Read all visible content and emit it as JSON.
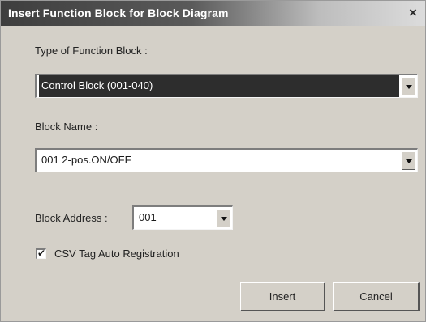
{
  "dialog": {
    "title": "Insert Function Block for Block Diagram",
    "close_glyph": "×"
  },
  "type_field": {
    "label": "Type of Function Block :",
    "value": "Control Block (001-040)"
  },
  "name_field": {
    "label": "Block Name :",
    "value": "001  2-pos.ON/OFF"
  },
  "address_field": {
    "label": "Block Address :",
    "value": "001"
  },
  "csv_checkbox": {
    "label": "CSV Tag Auto Registration",
    "checked": true,
    "check_glyph": "✔"
  },
  "buttons": {
    "insert": "Insert",
    "cancel": "Cancel"
  },
  "icons": {
    "close": "close-icon",
    "dropdown": "chevron-down-icon"
  },
  "colors": {
    "titlebar_dark": "#3e3e3e",
    "selection": "#2d2d2d",
    "face": "#d4d0c8"
  }
}
